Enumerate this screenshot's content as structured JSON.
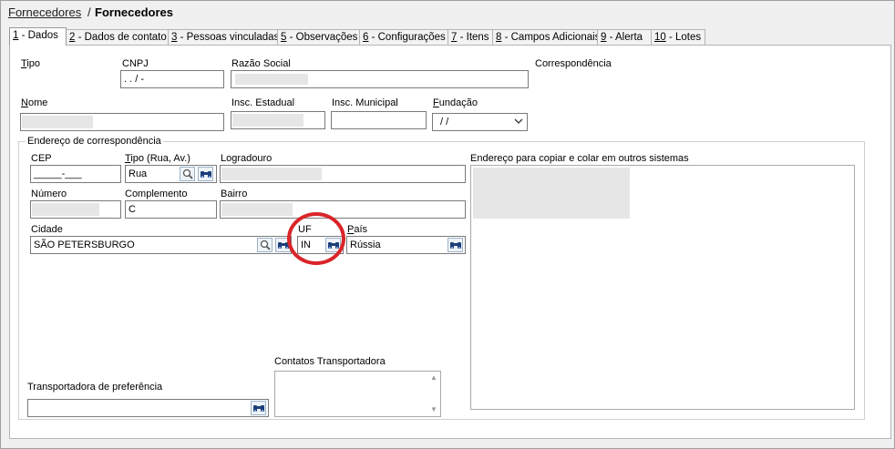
{
  "breadcrumb": {
    "parent": "Fornecedores",
    "separator": "/",
    "current": "Fornecedores"
  },
  "tabs": [
    {
      "num": "1",
      "label": " - Dados"
    },
    {
      "num": "2",
      "label": " - Dados de contato"
    },
    {
      "num": "3",
      "label": " - Pessoas vinculadas"
    },
    {
      "num": "5",
      "label": " - Observações"
    },
    {
      "num": "6",
      "label": " - Configurações"
    },
    {
      "num": "7",
      "label": " - Itens"
    },
    {
      "num": "8",
      "label": " - Campos Adicionais"
    },
    {
      "num": "9",
      "label": " - Alerta"
    },
    {
      "num": "10",
      "label": " - Lotes"
    }
  ],
  "form": {
    "tipo_label": "Tipo",
    "cnpj_label": "CNPJ",
    "cnpj_value": "  .  .  /  -",
    "razao_label": "Razão Social",
    "correspondencia_label": "Correspondência",
    "nome_label": "Nome",
    "insc_estadual_label": "Insc. Estadual",
    "insc_municipal_label": "Insc. Municipal",
    "fundacao_label": "Fundação",
    "fundacao_value": "/ /"
  },
  "address": {
    "group_title": "Endereço de correspondência",
    "cep_label": "CEP",
    "cep_value": "_____-___",
    "tipo_label": "Tipo (Rua, Av.)",
    "tipo_value": "Rua",
    "logradouro_label": "Logradouro",
    "copy_label": "Endereço para copiar e colar em outros sistemas",
    "numero_label": "Número",
    "complemento_label": "Complemento",
    "complemento_value": "C",
    "bairro_label": "Bairro",
    "cidade_label": "Cidade",
    "cidade_value": "SÃO PETERSBURGO",
    "uf_label": "UF",
    "uf_value": "IN",
    "pais_label": "País",
    "pais_value": "Rússia"
  },
  "transport": {
    "contatos_label": "Contatos Transportadora",
    "preferencia_label": "Transportadora de preferência"
  },
  "colors": {
    "annotation_ring": "#d9252a",
    "button_bg": "#eef3f8",
    "binoculars": "#1d3f7a"
  },
  "icons": [
    "binoculars-icon",
    "magnifier-icon",
    "chevron-down-icon"
  ]
}
